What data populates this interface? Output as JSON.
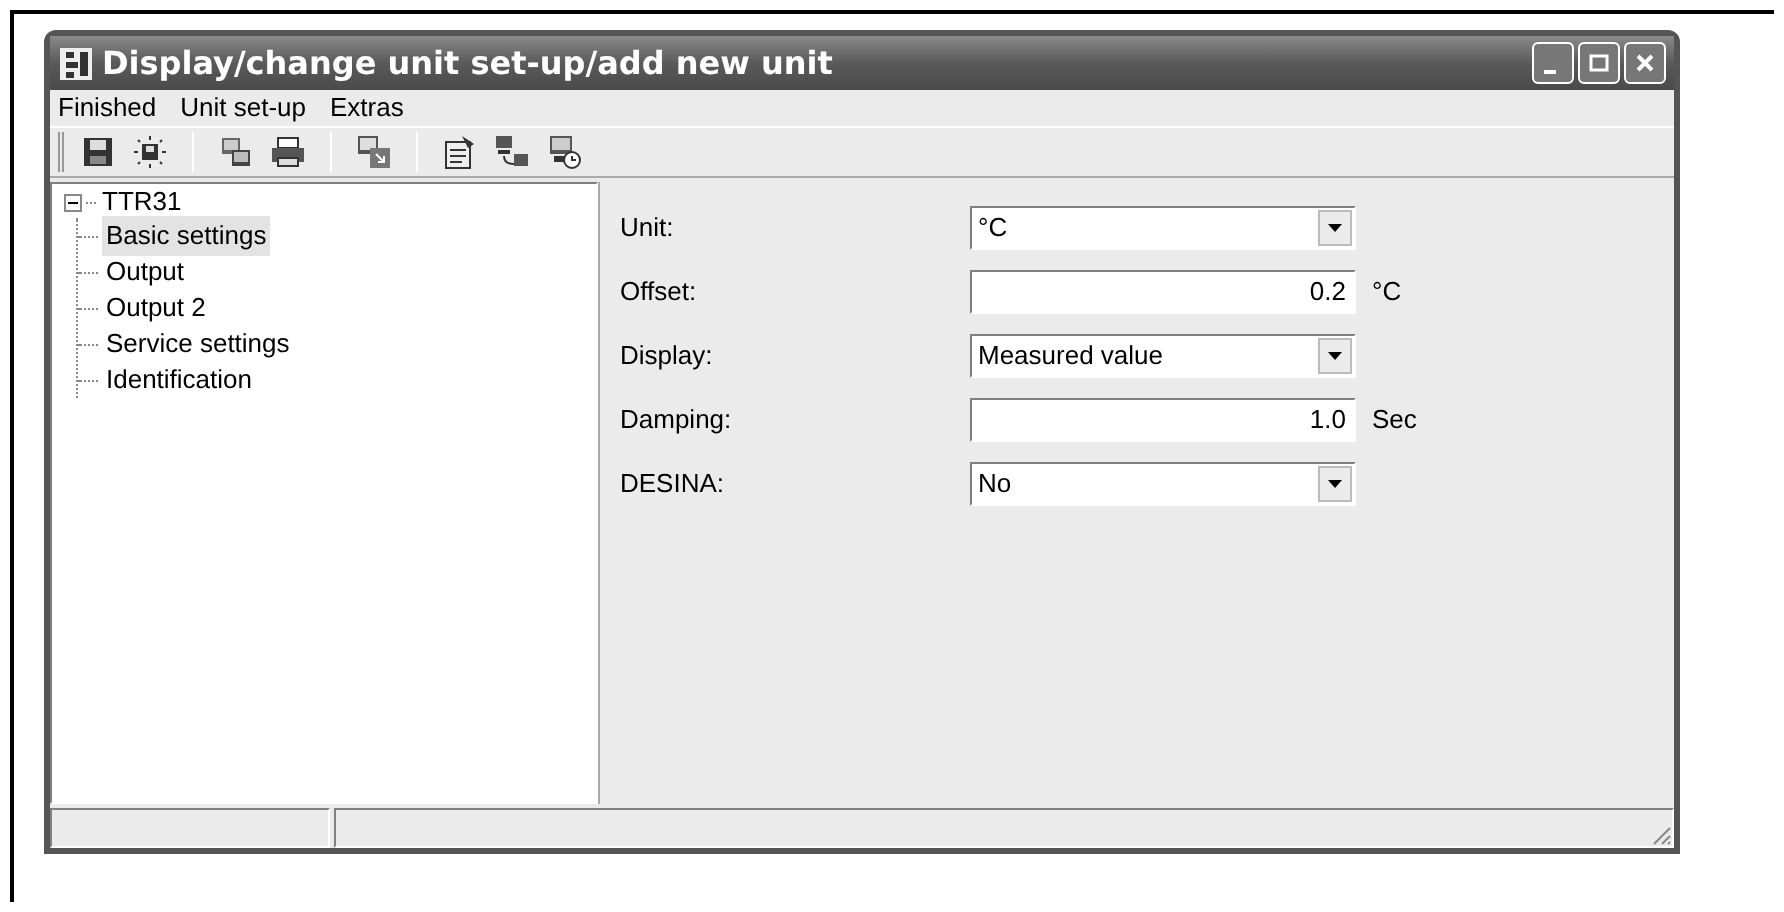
{
  "window": {
    "title": "Display/change unit set-up/add new unit"
  },
  "menu": [
    {
      "label": "Finished"
    },
    {
      "label": "Unit set-up"
    },
    {
      "label": "Extras"
    }
  ],
  "tree": {
    "label": "TTR31",
    "expanded": true,
    "children": [
      {
        "label": "Basic settings",
        "selected": true
      },
      {
        "label": "Output",
        "selected": false
      },
      {
        "label": "Output 2",
        "selected": false
      },
      {
        "label": "Service settings",
        "selected": false
      },
      {
        "label": "Identification",
        "selected": false
      }
    ]
  },
  "form": [
    {
      "kind": "dropdown",
      "label": "Unit:",
      "value": "°C"
    },
    {
      "kind": "number",
      "label": "Offset:",
      "value": "0.2",
      "unit": "°C"
    },
    {
      "kind": "dropdown",
      "label": "Display:",
      "value": "Measured value"
    },
    {
      "kind": "number",
      "label": "Damping:",
      "value": "1.0",
      "unit": "Sec"
    },
    {
      "kind": "dropdown",
      "label": "DESINA:",
      "value": "No"
    }
  ]
}
